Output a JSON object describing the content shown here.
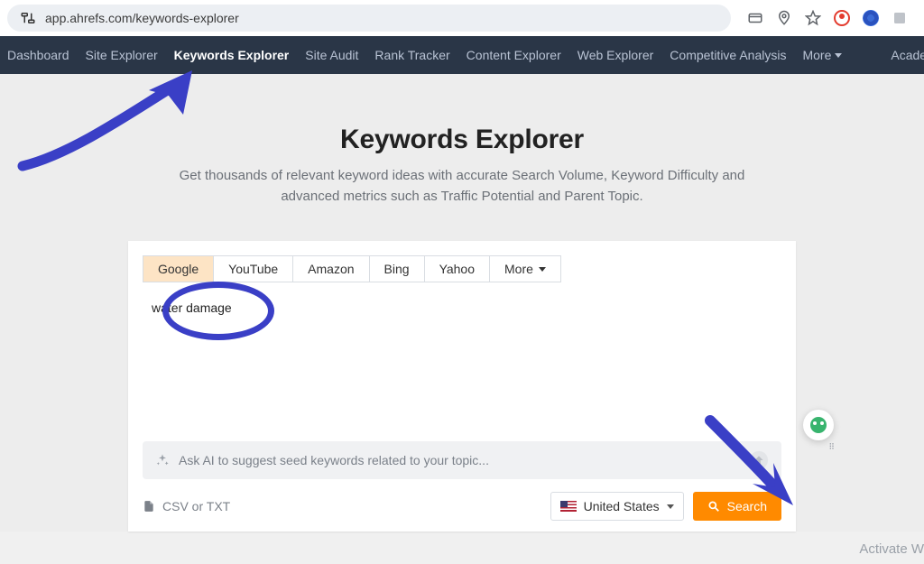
{
  "browser": {
    "url": "app.ahrefs.com/keywords-explorer"
  },
  "nav": {
    "items": [
      "Dashboard",
      "Site Explorer",
      "Keywords Explorer",
      "Site Audit",
      "Rank Tracker",
      "Content Explorer",
      "Web Explorer",
      "Competitive Analysis"
    ],
    "more": "More",
    "academy": "Academy",
    "active_index": 2
  },
  "page": {
    "title": "Keywords Explorer",
    "subtitle": "Get thousands of relevant keyword ideas with accurate Search Volume, Keyword Difficulty and advanced metrics such as Traffic Potential and Parent Topic."
  },
  "engines": {
    "tabs": [
      "Google",
      "YouTube",
      "Amazon",
      "Bing",
      "Yahoo"
    ],
    "more": "More",
    "active_index": 0
  },
  "query": {
    "value": "water damage"
  },
  "ai": {
    "placeholder": "Ask AI to suggest seed keywords related to your topic..."
  },
  "upload": {
    "label": "CSV or TXT"
  },
  "country": {
    "label": "United States"
  },
  "search": {
    "label": "Search"
  },
  "watermark": "Activate W"
}
